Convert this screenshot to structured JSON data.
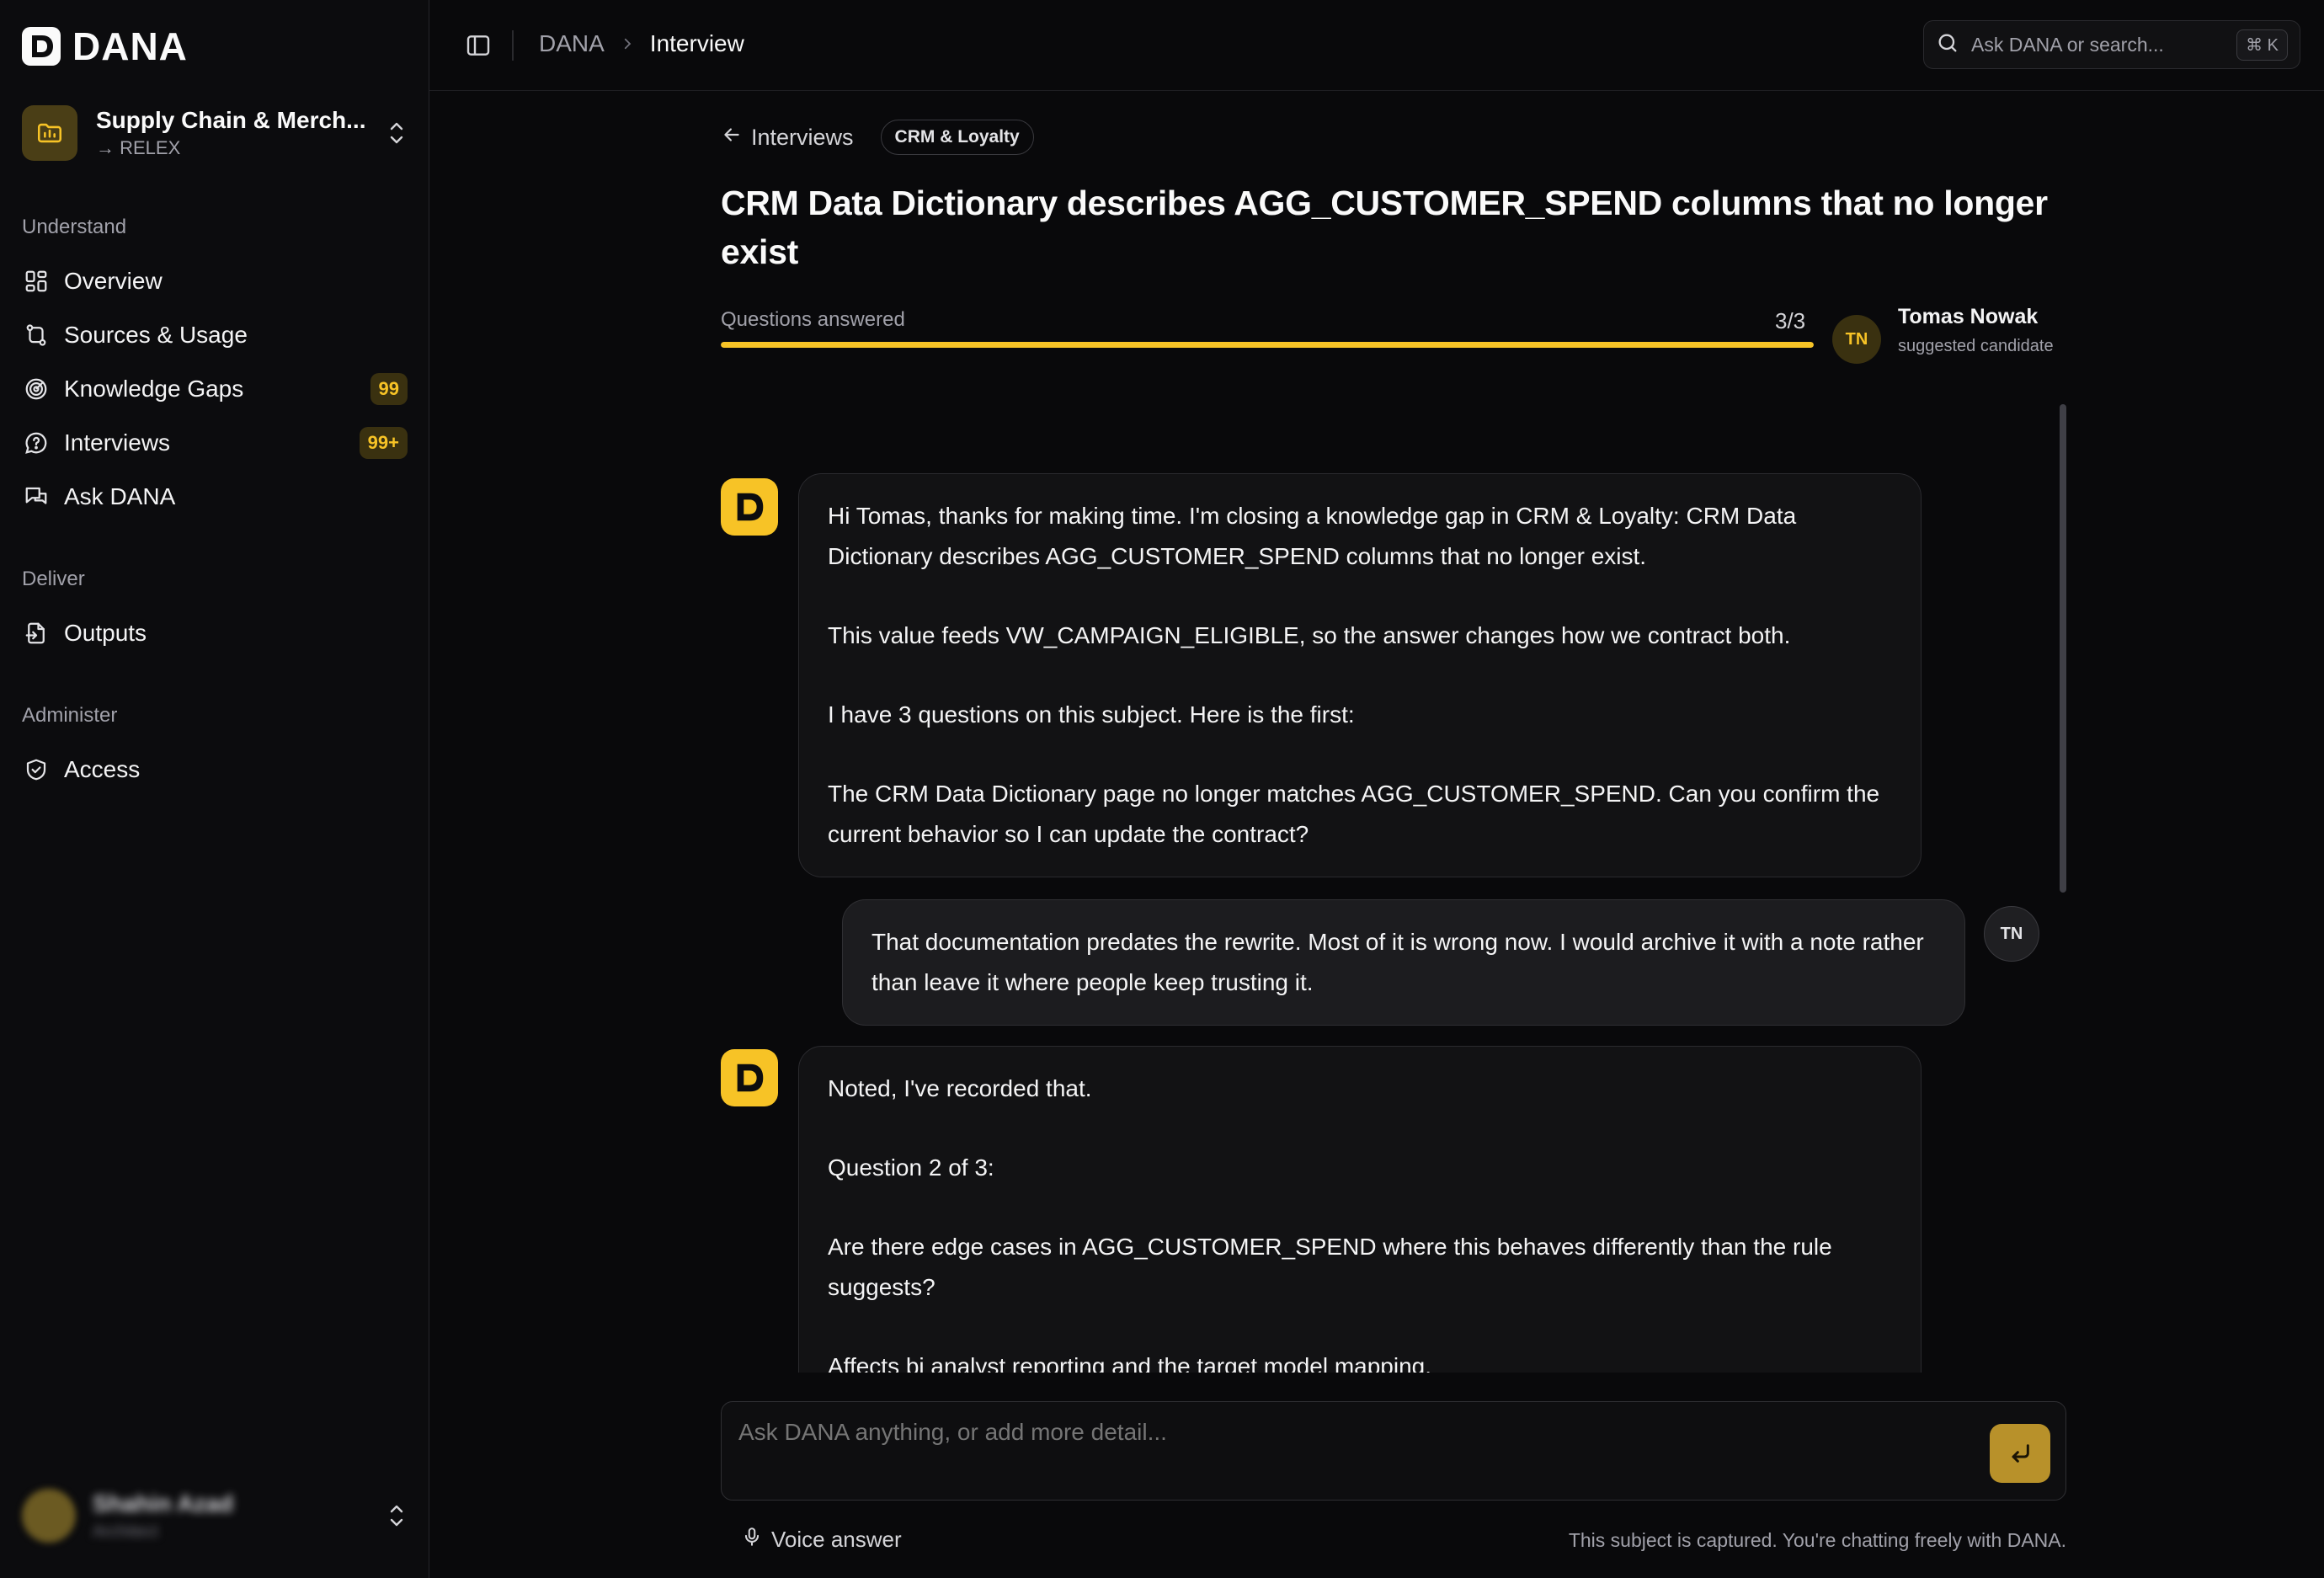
{
  "app": {
    "name": "DANA"
  },
  "workspace": {
    "name": "Supply Chain & Merch...",
    "sub": "→ RELEX"
  },
  "sidebar": {
    "sections": [
      {
        "title": "Understand",
        "items": [
          {
            "label": "Overview",
            "icon": "grid-icon"
          },
          {
            "label": "Sources & Usage",
            "icon": "route-icon"
          },
          {
            "label": "Knowledge Gaps",
            "icon": "target-icon",
            "badge": "99"
          },
          {
            "label": "Interviews",
            "icon": "message-question-icon",
            "badge": "99+"
          },
          {
            "label": "Ask DANA",
            "icon": "chat-icon"
          }
        ]
      },
      {
        "title": "Deliver",
        "items": [
          {
            "label": "Outputs",
            "icon": "file-export-icon"
          }
        ]
      },
      {
        "title": "Administer",
        "items": [
          {
            "label": "Access",
            "icon": "shield-check-icon"
          }
        ]
      }
    ],
    "user": {
      "name": "Shahin Azad",
      "role": "Architect",
      "initials": "SA"
    }
  },
  "topbar": {
    "breadcrumb": [
      "DANA",
      "Interview"
    ],
    "search_placeholder": "Ask DANA or search...",
    "shortcut": "⌘ K"
  },
  "page": {
    "back_label": "Interviews",
    "tag": "CRM & Loyalty",
    "title": "CRM Data Dictionary describes AGG_CUSTOMER_SPEND columns that no longer exist",
    "progress": {
      "label": "Questions answered",
      "count": "3/3",
      "fraction": 1.0
    },
    "candidate": {
      "initials": "TN",
      "name": "Tomas Nowak",
      "role": "suggested candidate"
    }
  },
  "messages": [
    {
      "from": "dana",
      "paragraphs": [
        "Hi Tomas, thanks for making time. I'm closing a knowledge gap in CRM & Loyalty: CRM Data Dictionary describes AGG_CUSTOMER_SPEND columns that no longer exist.",
        "This value feeds VW_CAMPAIGN_ELIGIBLE, so the answer changes how we contract both.",
        "I have 3 questions on this subject. Here is the first:",
        "The CRM Data Dictionary page no longer matches AGG_CUSTOMER_SPEND. Can you confirm the current behavior so I can update the contract?"
      ]
    },
    {
      "from": "user",
      "initials": "TN",
      "paragraphs": [
        "That documentation predates the rewrite. Most of it is wrong now. I would archive it with a note rather than leave it where people keep trusting it."
      ]
    },
    {
      "from": "dana",
      "paragraphs": [
        "Noted, I've recorded that.",
        "Question 2 of 3:",
        "Are there edge cases in AGG_CUSTOMER_SPEND where this behaves differently than the rule suggests?",
        "Affects bi analyst reporting and the target model mapping."
      ]
    },
    {
      "from": "user",
      "initials": "TN",
      "paragraphs": [
        ""
      ]
    }
  ],
  "composer": {
    "placeholder": "Ask DANA anything, or add more detail...",
    "voice_label": "Voice answer",
    "status": "This subject is captured. You're chatting freely with DANA."
  },
  "colors": {
    "accent": "#f7c326",
    "background": "#09090b",
    "sidebar": "#0c0c0e"
  }
}
